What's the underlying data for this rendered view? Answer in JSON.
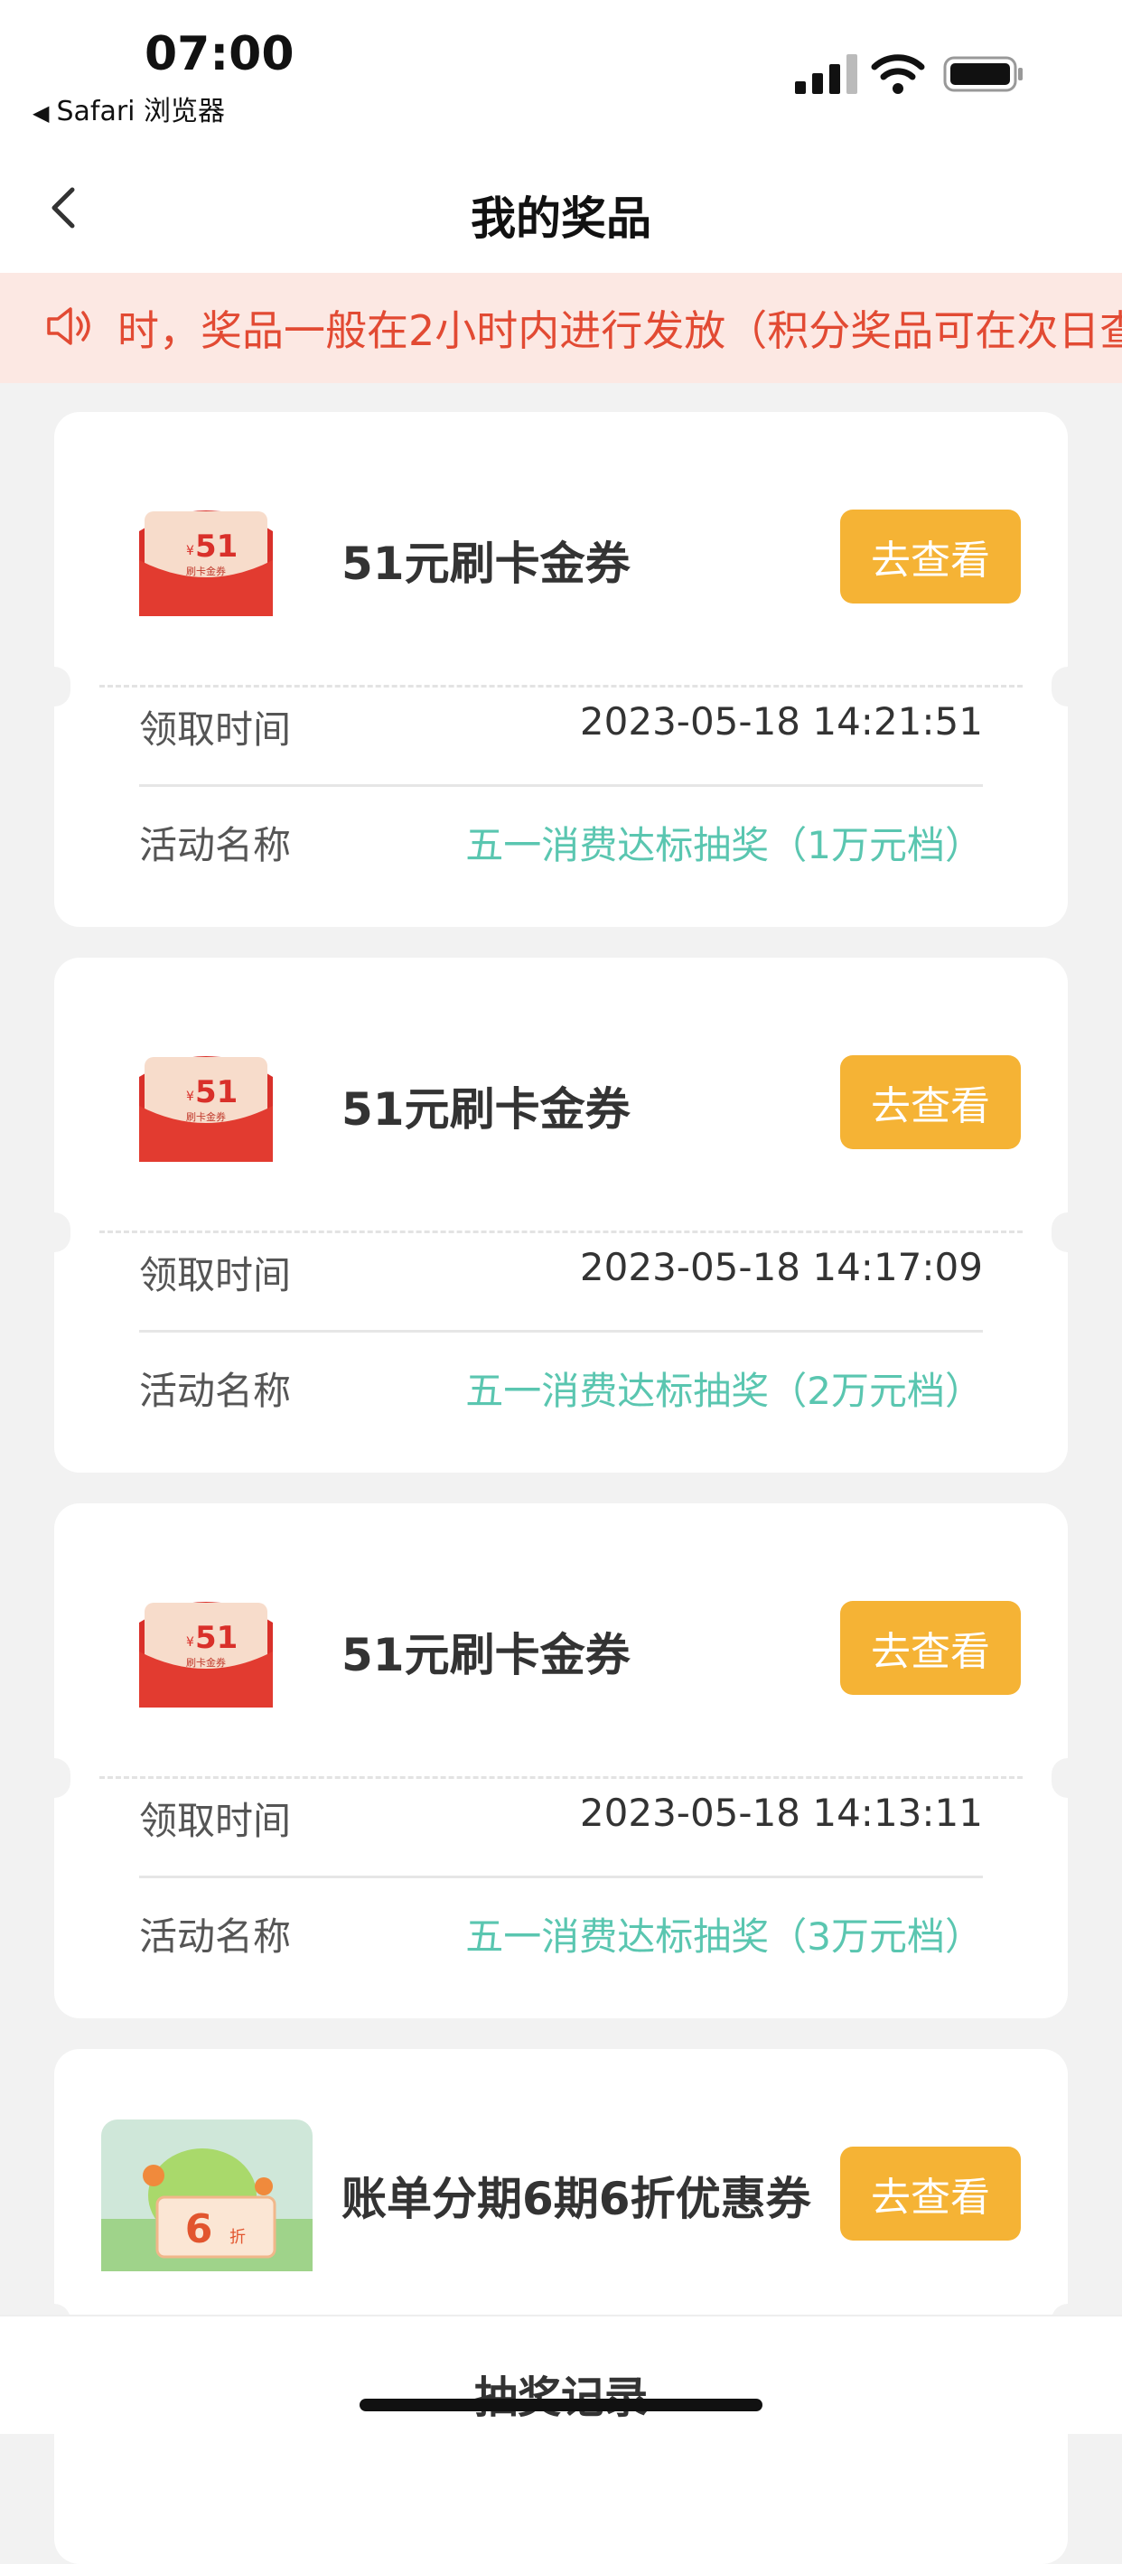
{
  "status_bar": {
    "time": "07:00",
    "back_app": "Safari 浏览器"
  },
  "nav": {
    "title": "我的奖品"
  },
  "notice": {
    "text": "时，奖品一般在2小时内进行发放（积分奖品可在次日查"
  },
  "prizes": [
    {
      "name": "51元刷卡金券",
      "button": "去查看",
      "coupon_amount": "51",
      "coupon_caption": "刷卡金券",
      "time_label": "领取时间",
      "time": "2023-05-18 14:21:51",
      "activity_label": "活动名称",
      "activity": "五一消费达标抽奖（1万元档）"
    },
    {
      "name": "51元刷卡金券",
      "button": "去查看",
      "coupon_amount": "51",
      "coupon_caption": "刷卡金券",
      "time_label": "领取时间",
      "time": "2023-05-18 14:17:09",
      "activity_label": "活动名称",
      "activity": "五一消费达标抽奖（2万元档）"
    },
    {
      "name": "51元刷卡金券",
      "button": "去查看",
      "coupon_amount": "51",
      "coupon_caption": "刷卡金券",
      "time_label": "领取时间",
      "time": "2023-05-18 14:13:11",
      "activity_label": "活动名称",
      "activity": "五一消费达标抽奖（3万元档）"
    },
    {
      "name": "账单分期6期6折优惠券",
      "button": "去查看",
      "coupon_amount": "6",
      "coupon_unit": "折"
    }
  ],
  "bottom": {
    "label": "抽奖记录"
  },
  "colors": {
    "accent_button": "#f5b335",
    "notice_text": "#e24a33",
    "activity_text": "#5ac6b0"
  }
}
